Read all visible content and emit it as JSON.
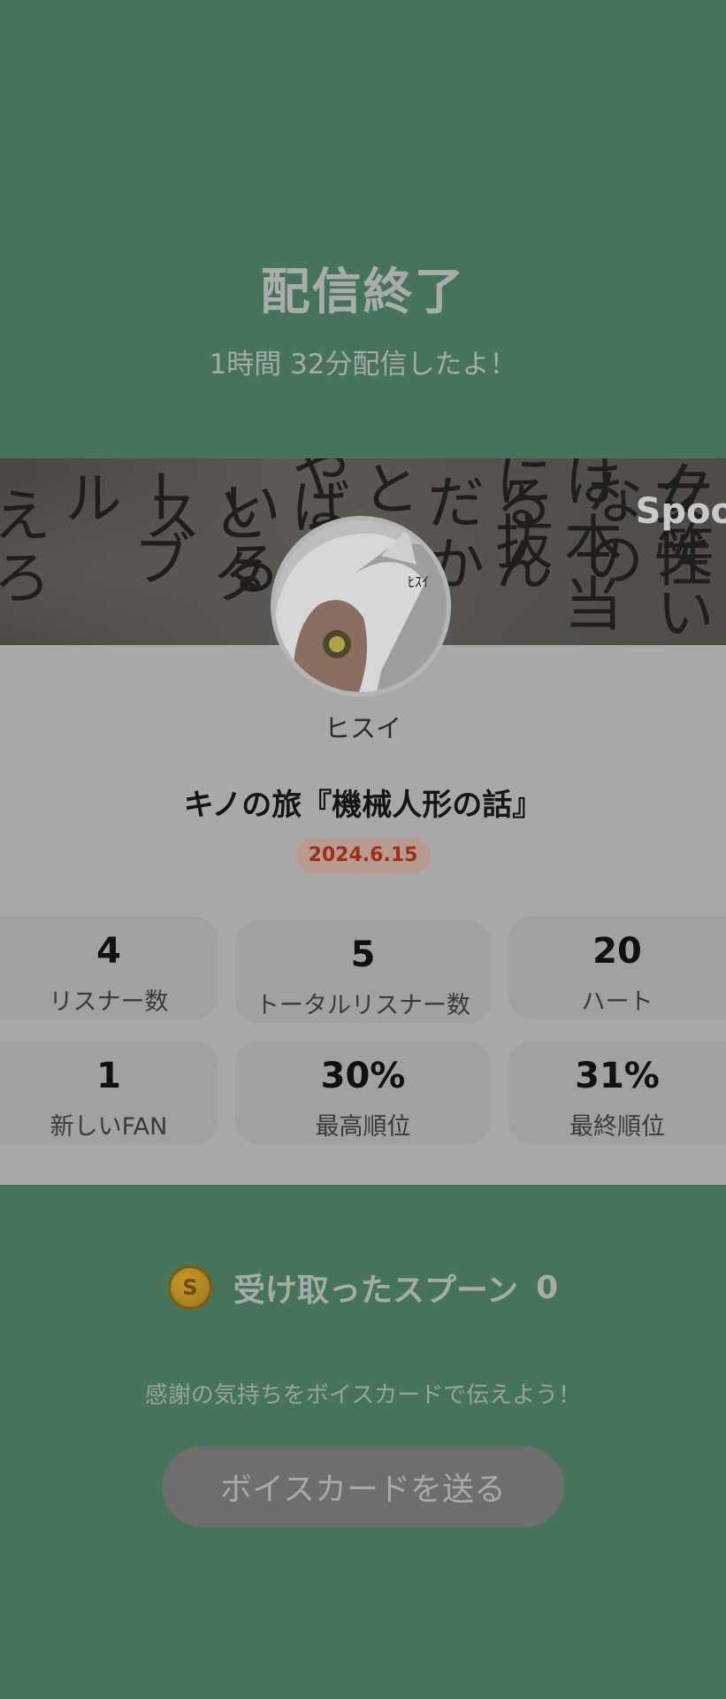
{
  "header": {
    "title": "配信終了",
    "subtitle": "1時間 32分配信したよ！"
  },
  "banner": {
    "text_columns": [
      "ク笑い",
      "女性なの",
      "は本当に抜",
      "るんだか",
      "とかに",
      "やっ",
      "ばにいる",
      "とタス",
      "ーブル",
      "えろ"
    ],
    "brand_partial": "Spoo"
  },
  "profile": {
    "username": "ヒスイ",
    "avatar_icon": "avatar-image",
    "avatar_sign": "ﾋｽｲ"
  },
  "broadcast": {
    "title": "キノの旅『機械人形の話』",
    "date": "2024.6.15"
  },
  "stats": [
    {
      "value": "4",
      "label": "リスナー数"
    },
    {
      "value": "5",
      "label": "トータルリスナー数"
    },
    {
      "value": "20",
      "label": "ハート"
    },
    {
      "value": "1",
      "label": "新しいFAN"
    },
    {
      "value": "30%",
      "label": "最高順位"
    },
    {
      "value": "31%",
      "label": "最終順位"
    }
  ],
  "spoons": {
    "coin_symbol": "S",
    "label": "受け取ったスプーン",
    "count": "0"
  },
  "thanks_text": "感謝の気持ちをボイスカードで伝えよう！",
  "voice_card_button": "ボイスカードを送る",
  "colors": {
    "background": "#46745a",
    "card": "#a8a8a8",
    "date_text": "#9e2f12",
    "button": "#6e6e6e"
  }
}
